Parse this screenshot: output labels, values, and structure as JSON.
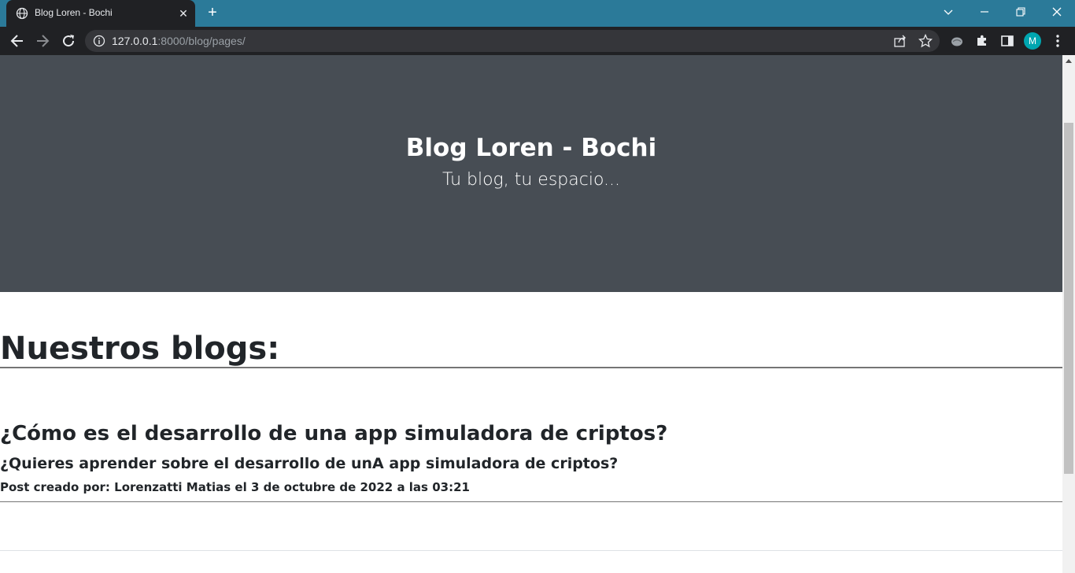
{
  "browser": {
    "tab_title": "Blog Loren - Bochi",
    "url_host": "127.0.0.1",
    "url_path": ":8000/blog/pages/",
    "profile_initial": "M",
    "icons": [
      "globe-icon",
      "close-icon",
      "plus-icon",
      "chevron-down-icon",
      "minimize-icon",
      "restore-icon",
      "window-close-icon",
      "back-icon",
      "forward-icon",
      "reload-icon",
      "info-icon",
      "share-icon",
      "star-icon",
      "extension-leaf-icon",
      "puzzle-icon",
      "side-panel-icon",
      "kebab-menu-icon"
    ]
  },
  "hero": {
    "title": "Blog Loren - Bochi",
    "subtitle": "Tu blog, tu espacio..."
  },
  "main": {
    "section_title": "Nuestros blogs:",
    "posts": [
      {
        "title": "¿Cómo es el desarrollo de una app simuladora de criptos?",
        "subtitle": "¿Quieres aprender sobre el desarrollo de unA app simuladora de criptos?",
        "meta": "Post creado por: Lorenzatti Matias el 3 de octubre de 2022 a las 03:21"
      }
    ]
  },
  "colors": {
    "tabstrip": "#2b7a99",
    "toolbar": "#202124",
    "hero_bg": "#474d54",
    "text": "#212529",
    "avatar": "#00a6b0"
  }
}
